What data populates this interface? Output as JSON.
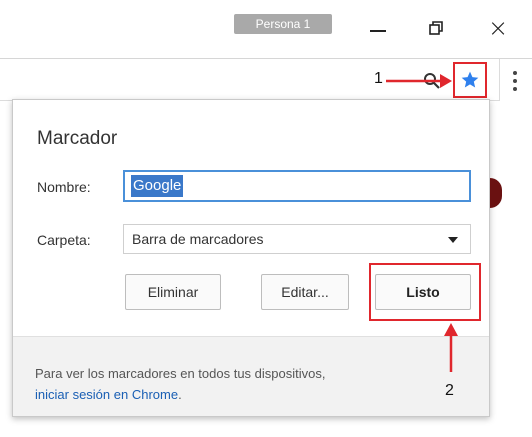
{
  "window": {
    "profile_badge": "Persona 1",
    "minimize_icon": "minimize-icon",
    "restore_icon": "restore-icon",
    "close_glyph": "×"
  },
  "toolbar": {
    "zoom_icon": "magnifier-icon",
    "bookmark_star_icon": "star-icon",
    "menu_icon": "vertical-dots-icon",
    "star_color": "#2f80ed"
  },
  "annotations": {
    "callout_1": "1",
    "callout_2": "2",
    "highlight_color": "#e0272d"
  },
  "bookmark_popup": {
    "title": "Marcador",
    "name_label": "Nombre:",
    "name_value": "Google",
    "folder_label": "Carpeta:",
    "folder_value": "Barra de marcadores",
    "remove_button": "Eliminar",
    "edit_button": "Editar...",
    "done_button": "Listo",
    "footer_text": "Para ver los marcadores en todos tus dispositivos,",
    "footer_link": "iniciar sesión en Chrome",
    "footer_suffix": "."
  }
}
